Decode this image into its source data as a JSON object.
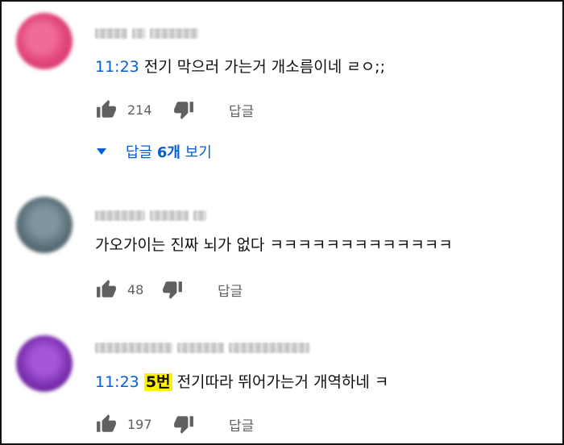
{
  "comments": [
    {
      "timestamp": "11:23",
      "text": "전기 막으러 가는거 개소름이네 ㄹㅇ;;",
      "likes": "214",
      "reply_label": "답글",
      "avatar_color": "#e0457b",
      "view_replies": {
        "prefix": "답글 ",
        "count": "6개",
        "suffix": " 보기"
      }
    },
    {
      "timestamp": "",
      "text": "가오가이는 진짜 뇌가 없다 ㅋㅋㅋㅋㅋㅋㅋㅋㅋㅋㅋㅋㅋ",
      "likes": "48",
      "reply_label": "답글",
      "avatar_color": "#5a6f78"
    },
    {
      "timestamp": "11:23",
      "highlight": "5번",
      "text": "전기따라 뛰어가는거 개역하네 ㅋ",
      "likes": "197",
      "reply_label": "답글",
      "avatar_color": "#7b2fae"
    }
  ],
  "colors": {
    "link": "#065fd4",
    "secondary": "#606060",
    "highlight": "#fff200"
  }
}
